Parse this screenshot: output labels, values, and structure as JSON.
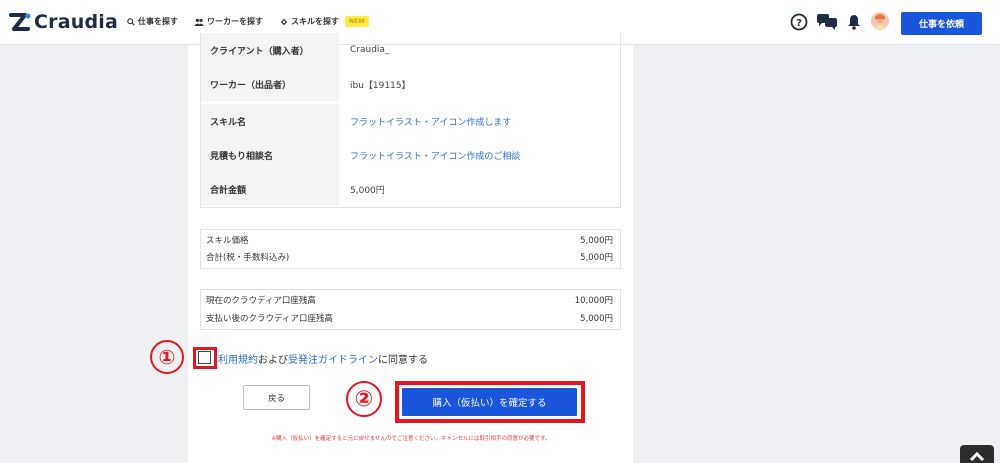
{
  "header": {
    "logo_text": "Craudia",
    "nav": [
      {
        "label": "仕事を探す",
        "icon": "search-icon"
      },
      {
        "label": "ワーカーを探す",
        "icon": "users-icon"
      },
      {
        "label": "スキルを探す",
        "icon": "skill-icon",
        "badge": "NEW"
      }
    ],
    "cta_label": "仕事を依頼",
    "colors": {
      "brand": "#1a56db",
      "logo": "#1f2d44"
    }
  },
  "details": [
    {
      "label": "クライアント（購入者）",
      "value": "Craudia_",
      "link": false
    },
    {
      "label": "ワーカー（出品者）",
      "value": "ibu【19115】",
      "link": false
    },
    {
      "label": "スキル名",
      "value": "フラットイラスト・アイコン作成します",
      "link": true
    },
    {
      "label": "見積もり相談名",
      "value": "フラットイラスト・アイコン作成のご相談",
      "link": true
    },
    {
      "label": "合計金額",
      "value": "5,000円",
      "link": false
    }
  ],
  "price_box": [
    {
      "label": "スキル価格",
      "value": "5,000円"
    },
    {
      "label": "合計(税・手数料込み)",
      "value": "5,000円"
    }
  ],
  "balance_box": [
    {
      "label": "現在のクラウディア口座残高",
      "value": "10,000円"
    },
    {
      "label": "支払い後のクラウディア口座残高",
      "value": "5,000円"
    }
  ],
  "agreement": {
    "terms_link": "利用規約",
    "and_text": "および",
    "guideline_link": "受発注ガイドライン",
    "suffix": "に同意する",
    "checked": false
  },
  "buttons": {
    "back": "戻る",
    "confirm": "購入（仮払い）を確定する"
  },
  "note": "※購入（仮払い）を確定すると元に戻せませんのでご注意ください。キャンセルには取引相手の同意が必要です。",
  "annotations": {
    "one": "①",
    "two": "②",
    "color": "#e8141f"
  }
}
